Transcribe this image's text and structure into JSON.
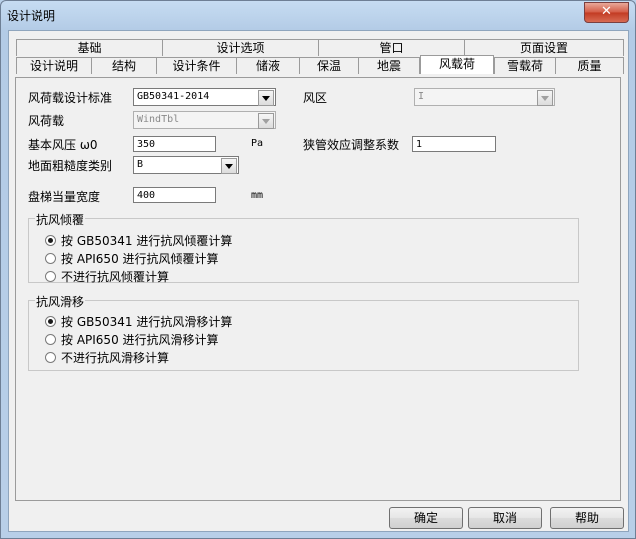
{
  "window": {
    "title": "设计说明",
    "close_glyph": "✕"
  },
  "tabs_row1": [
    {
      "label": "基础"
    },
    {
      "label": "设计选项"
    },
    {
      "label": "管口"
    },
    {
      "label": "页面设置"
    }
  ],
  "tabs_row2": [
    {
      "label": "设计说明"
    },
    {
      "label": "结构"
    },
    {
      "label": "设计条件"
    },
    {
      "label": "储液"
    },
    {
      "label": "保温"
    },
    {
      "label": "地震"
    },
    {
      "label": "风载荷"
    },
    {
      "label": "雪载荷"
    },
    {
      "label": "质量"
    }
  ],
  "form": {
    "standard_label": "风荷载设计标准",
    "standard_value": "GB50341-2014",
    "wind_zone_label": "风区",
    "wind_zone_value": "I",
    "wind_load_label": "风荷载",
    "wind_load_value": "WindTbl",
    "pressure_label": "基本风压 ω0",
    "pressure_value": "350",
    "pressure_unit": "Pa",
    "pipe_coef_label": "狭管效应调整系数",
    "pipe_coef_value": "1",
    "roughness_label": "地面粗糙度类别",
    "roughness_value": "B",
    "stair_label": "盘梯当量宽度",
    "stair_value": "400",
    "stair_unit": "mm"
  },
  "overturn": {
    "title": "抗风倾覆",
    "options": [
      "按 GB50341 进行抗风倾覆计算",
      "按 API650 进行抗风倾覆计算",
      "不进行抗风倾覆计算"
    ],
    "selected": 0
  },
  "sliding": {
    "title": "抗风滑移",
    "options": [
      "按 GB50341 进行抗风滑移计算",
      "按 API650 进行抗风滑移计算",
      "不进行抗风滑移计算"
    ],
    "selected": 0
  },
  "buttons": {
    "ok": "确定",
    "cancel": "取消",
    "help": "帮助"
  }
}
